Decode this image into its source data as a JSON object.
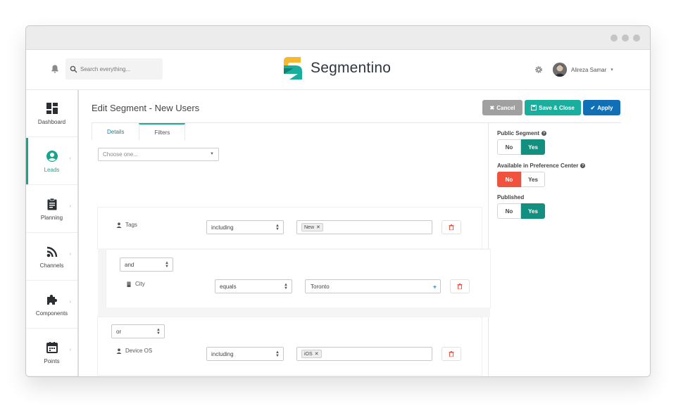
{
  "header": {
    "search_placeholder": "Search everything...",
    "app_name": "Segmentino",
    "user_name": "Alireza Samar"
  },
  "sidebar": {
    "items": [
      {
        "label": "Dashboard",
        "icon": "dashboard-icon"
      },
      {
        "label": "Leads",
        "icon": "user-circle-icon",
        "active": true
      },
      {
        "label": "Planning",
        "icon": "clipboard-icon"
      },
      {
        "label": "Channels",
        "icon": "rss-icon"
      },
      {
        "label": "Components",
        "icon": "puzzle-icon"
      },
      {
        "label": "Points",
        "icon": "calendar-icon"
      }
    ]
  },
  "page": {
    "title": "Edit Segment - New Users",
    "buttons": {
      "cancel": "Cancel",
      "save_close": "Save & Close",
      "apply": "Apply"
    },
    "tabs": [
      "Details",
      "Filters"
    ],
    "active_tab": "Filters"
  },
  "filters": {
    "choose_placeholder": "Choose one...",
    "rows": [
      {
        "field": "Tags",
        "operator": "including",
        "tags": [
          "New"
        ]
      },
      {
        "glue": "and",
        "field": "City",
        "operator": "equals",
        "value": "Toronto"
      },
      {
        "glue": "or",
        "field": "Device OS",
        "operator": "including",
        "tags": [
          "iOS"
        ]
      }
    ]
  },
  "settings": {
    "public_segment": {
      "label": "Public Segment",
      "no": "No",
      "yes": "Yes",
      "selected": "Yes"
    },
    "preference_center": {
      "label": "Available in Preference Center",
      "no": "No",
      "yes": "Yes",
      "selected": "No"
    },
    "published": {
      "label": "Published",
      "no": "No",
      "yes": "Yes",
      "selected": "Yes"
    }
  },
  "colors": {
    "accent": "#17a589",
    "save": "#1aae9f",
    "apply": "#1170b5",
    "cancel": "#a0a0a0",
    "danger": "#f0523e"
  }
}
